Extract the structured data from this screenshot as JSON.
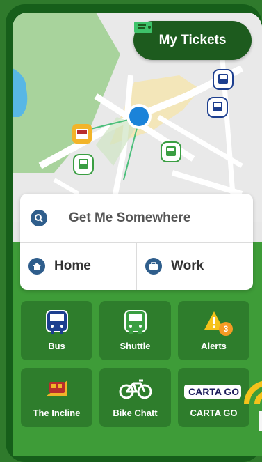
{
  "header": {
    "my_tickets_label": "My Tickets"
  },
  "search": {
    "label": "Get Me Somewhere"
  },
  "places": [
    {
      "label": "Home",
      "icon": "home-icon"
    },
    {
      "label": "Work",
      "icon": "briefcase-icon"
    }
  ],
  "tiles": [
    {
      "label": "Bus",
      "icon": "bus-icon"
    },
    {
      "label": "Shuttle",
      "icon": "shuttle-icon"
    },
    {
      "label": "Alerts",
      "icon": "alert-icon",
      "badge": "3"
    },
    {
      "label": "The Incline",
      "icon": "incline-icon"
    },
    {
      "label": "Bike Chatt",
      "icon": "bike-icon"
    },
    {
      "label": "CARTA GO",
      "icon": "carta-go-logo",
      "logo_text": "CARTA GO"
    }
  ],
  "colors": {
    "primary_green": "#1d5b1e",
    "tile_green": "#2e7d2c",
    "panel_green": "#3e9c38",
    "badge_orange": "#f59a23",
    "bus_blue": "#1d3f8f"
  }
}
